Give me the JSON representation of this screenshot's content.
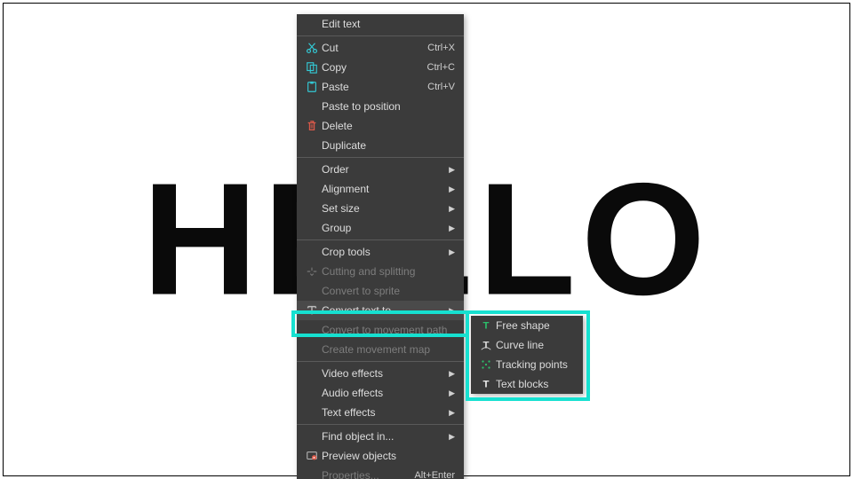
{
  "canvas": {
    "background_text": "HELLO"
  },
  "highlight_color": "#16e0d0",
  "context_menu": {
    "items": [
      {
        "label": "Edit text",
        "icon": "",
        "type": "item",
        "enabled": true
      },
      {
        "type": "sep"
      },
      {
        "label": "Cut",
        "shortcut": "Ctrl+X",
        "icon": "cut",
        "type": "item",
        "enabled": true
      },
      {
        "label": "Copy",
        "shortcut": "Ctrl+C",
        "icon": "copy",
        "type": "item",
        "enabled": true
      },
      {
        "label": "Paste",
        "shortcut": "Ctrl+V",
        "icon": "paste",
        "type": "item",
        "enabled": true
      },
      {
        "label": "Paste to position",
        "icon": "",
        "type": "item",
        "enabled": true
      },
      {
        "label": "Delete",
        "icon": "trash",
        "type": "item",
        "enabled": true
      },
      {
        "label": "Duplicate",
        "icon": "",
        "type": "item",
        "enabled": true
      },
      {
        "type": "sep"
      },
      {
        "label": "Order",
        "type": "submenu",
        "enabled": true
      },
      {
        "label": "Alignment",
        "type": "submenu",
        "enabled": true
      },
      {
        "label": "Set size",
        "type": "submenu",
        "enabled": true
      },
      {
        "label": "Group",
        "type": "submenu",
        "enabled": true
      },
      {
        "type": "sep"
      },
      {
        "label": "Crop tools",
        "type": "submenu",
        "enabled": true
      },
      {
        "label": "Cutting and splitting",
        "icon": "split",
        "type": "item",
        "enabled": false
      },
      {
        "label": "Convert to sprite",
        "type": "item",
        "enabled": false
      },
      {
        "label": "Convert text to...",
        "icon": "text",
        "type": "submenu",
        "enabled": true,
        "active": true
      },
      {
        "label": "Convert to movement path",
        "type": "item",
        "enabled": false
      },
      {
        "label": "Create movement map",
        "type": "item",
        "enabled": false
      },
      {
        "type": "sep"
      },
      {
        "label": "Video effects",
        "type": "submenu",
        "enabled": true
      },
      {
        "label": "Audio effects",
        "type": "submenu",
        "enabled": true
      },
      {
        "label": "Text effects",
        "type": "submenu",
        "enabled": true
      },
      {
        "type": "sep"
      },
      {
        "label": "Find object in...",
        "type": "submenu",
        "enabled": true
      },
      {
        "label": "Preview objects",
        "icon": "preview",
        "type": "item",
        "enabled": true
      },
      {
        "label": "Properties...",
        "shortcut": "Alt+Enter",
        "type": "item",
        "enabled": false
      }
    ]
  },
  "submenu": {
    "items": [
      {
        "label": "Free shape",
        "icon": "free-shape"
      },
      {
        "label": "Curve line",
        "icon": "curve-line"
      },
      {
        "label": "Tracking points",
        "icon": "tracking"
      },
      {
        "label": "Text blocks",
        "icon": "text-blocks"
      }
    ]
  }
}
